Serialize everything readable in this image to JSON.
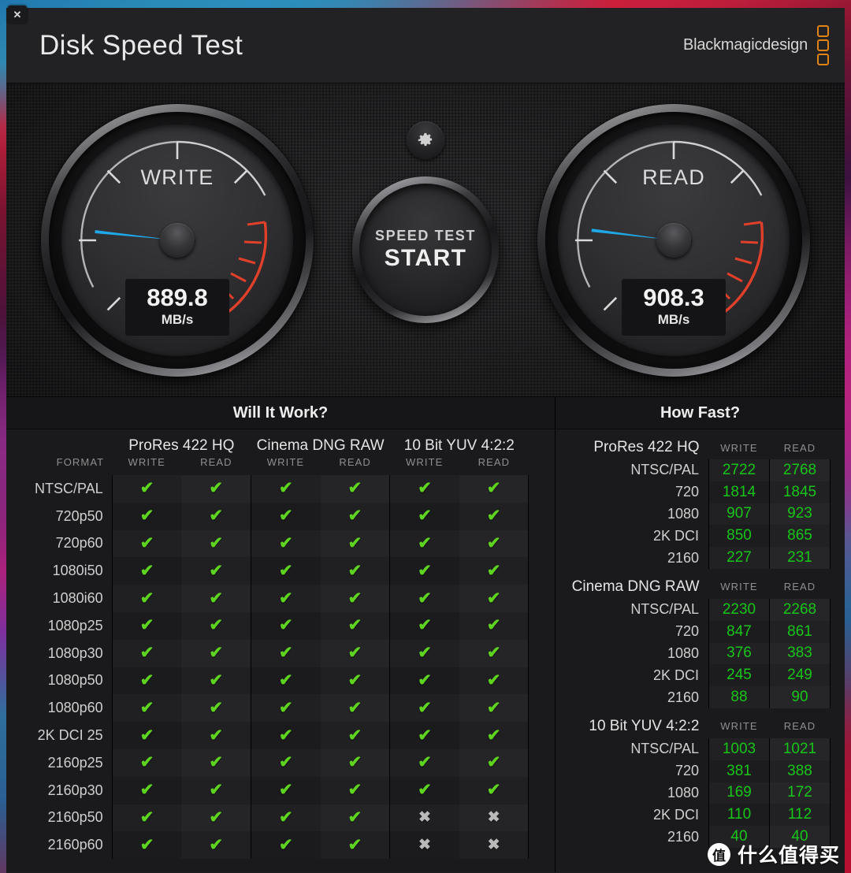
{
  "window": {
    "title": "Disk Speed Test",
    "close_label": "✕",
    "brand_text": "Blackmagicdesign"
  },
  "colors": {
    "needle": "#1fa8e8",
    "redzone": "#e0402a",
    "check_green": "#5ed320",
    "value_green": "#18c518",
    "brand_orange": "#e08214"
  },
  "gauges": {
    "write": {
      "label": "WRITE",
      "value": "889.8",
      "unit": "MB/s",
      "needle_angle_deg": 186
    },
    "read": {
      "label": "READ",
      "value": "908.3",
      "unit": "MB/s",
      "needle_angle_deg": 187
    }
  },
  "controls": {
    "gear_icon": "gear-icon",
    "start_line1": "SPEED TEST",
    "start_line2": "START"
  },
  "will_it_work": {
    "title": "Will It Work?",
    "format_header": "FORMAT",
    "codecs": [
      "ProRes 422 HQ",
      "Cinema DNG RAW",
      "10 Bit YUV 4:2:2"
    ],
    "sub_headers": [
      "WRITE",
      "READ"
    ],
    "ok_glyph": "✔",
    "no_glyph": "✖",
    "rows": [
      {
        "format": "NTSC/PAL",
        "cells": [
          true,
          true,
          true,
          true,
          true,
          true
        ]
      },
      {
        "format": "720p50",
        "cells": [
          true,
          true,
          true,
          true,
          true,
          true
        ]
      },
      {
        "format": "720p60",
        "cells": [
          true,
          true,
          true,
          true,
          true,
          true
        ]
      },
      {
        "format": "1080i50",
        "cells": [
          true,
          true,
          true,
          true,
          true,
          true
        ]
      },
      {
        "format": "1080i60",
        "cells": [
          true,
          true,
          true,
          true,
          true,
          true
        ]
      },
      {
        "format": "1080p25",
        "cells": [
          true,
          true,
          true,
          true,
          true,
          true
        ]
      },
      {
        "format": "1080p30",
        "cells": [
          true,
          true,
          true,
          true,
          true,
          true
        ]
      },
      {
        "format": "1080p50",
        "cells": [
          true,
          true,
          true,
          true,
          true,
          true
        ]
      },
      {
        "format": "1080p60",
        "cells": [
          true,
          true,
          true,
          true,
          true,
          true
        ]
      },
      {
        "format": "2K DCI 25",
        "cells": [
          true,
          true,
          true,
          true,
          true,
          true
        ]
      },
      {
        "format": "2160p25",
        "cells": [
          true,
          true,
          true,
          true,
          true,
          true
        ]
      },
      {
        "format": "2160p30",
        "cells": [
          true,
          true,
          true,
          true,
          true,
          true
        ]
      },
      {
        "format": "2160p50",
        "cells": [
          true,
          true,
          true,
          true,
          false,
          false
        ]
      },
      {
        "format": "2160p60",
        "cells": [
          true,
          true,
          true,
          true,
          false,
          false
        ]
      }
    ]
  },
  "how_fast": {
    "title": "How Fast?",
    "sub_headers": [
      "WRITE",
      "READ"
    ],
    "groups": [
      {
        "codec": "ProRes 422 HQ",
        "rows": [
          {
            "name": "NTSC/PAL",
            "write": "2722",
            "read": "2768"
          },
          {
            "name": "720",
            "write": "1814",
            "read": "1845"
          },
          {
            "name": "1080",
            "write": "907",
            "read": "923"
          },
          {
            "name": "2K DCI",
            "write": "850",
            "read": "865"
          },
          {
            "name": "2160",
            "write": "227",
            "read": "231"
          }
        ]
      },
      {
        "codec": "Cinema DNG RAW",
        "rows": [
          {
            "name": "NTSC/PAL",
            "write": "2230",
            "read": "2268"
          },
          {
            "name": "720",
            "write": "847",
            "read": "861"
          },
          {
            "name": "1080",
            "write": "376",
            "read": "383"
          },
          {
            "name": "2K DCI",
            "write": "245",
            "read": "249"
          },
          {
            "name": "2160",
            "write": "88",
            "read": "90"
          }
        ]
      },
      {
        "codec": "10 Bit YUV 4:2:2",
        "rows": [
          {
            "name": "NTSC/PAL",
            "write": "1003",
            "read": "1021"
          },
          {
            "name": "720",
            "write": "381",
            "read": "388"
          },
          {
            "name": "1080",
            "write": "169",
            "read": "172"
          },
          {
            "name": "2K DCI",
            "write": "110",
            "read": "112"
          },
          {
            "name": "2160",
            "write": "40",
            "read": "40"
          }
        ]
      }
    ]
  },
  "watermark": {
    "badge": "值",
    "text": "什么值得买"
  }
}
